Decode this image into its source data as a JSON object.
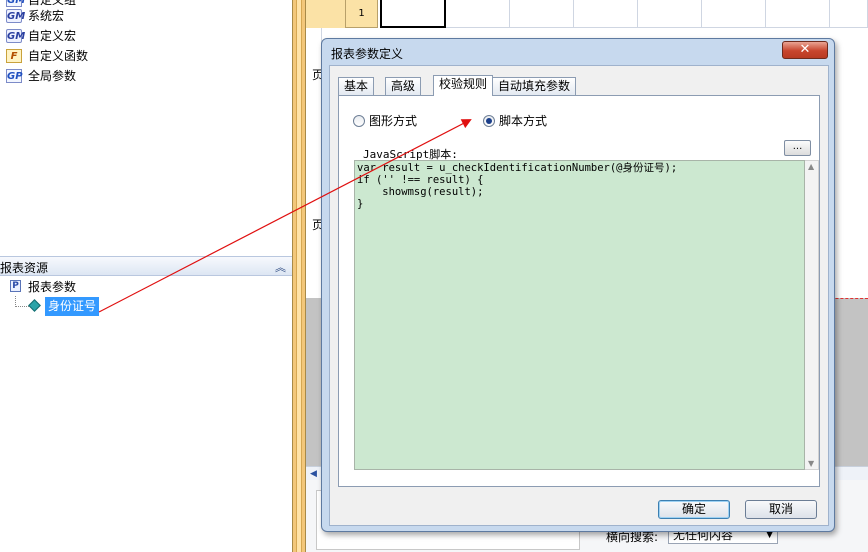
{
  "tree": {
    "items": [
      {
        "label": "自定义组",
        "icon": "group-icon"
      },
      {
        "label": "系统宏",
        "icon": "system-macro-icon"
      },
      {
        "label": "自定义宏",
        "icon": "custom-macro-icon"
      },
      {
        "label": "自定义函数",
        "icon": "custom-function-icon"
      },
      {
        "label": "全局参数",
        "icon": "global-param-icon"
      }
    ],
    "icon_text": {
      "macro": "GM",
      "func": "F",
      "global": "GP",
      "param": "P"
    }
  },
  "resources": {
    "header": "报表资源",
    "collapse_glyph": "︽",
    "params_label": "报表参数",
    "selected_param": "身份证号"
  },
  "designer": {
    "row_number": "1",
    "band_label_1": "页",
    "band_label_2": "页",
    "search_label": "横向搜索:",
    "search_value": "无任何内容"
  },
  "dialog": {
    "title": "报表参数定义",
    "close_glyph": "✕",
    "tabs": [
      {
        "label": "基本",
        "active": false
      },
      {
        "label": "高级",
        "active": false
      },
      {
        "label": "校验规则",
        "active": true
      },
      {
        "label": "自动填充参数",
        "active": false
      }
    ],
    "radio_graphic": "图形方式",
    "radio_script": "脚本方式",
    "selected_mode": "脚本方式",
    "script_label": "JavaScript脚本:",
    "more_button": "...",
    "script": "var result = u_checkIdentificationNumber(@身份证号);\nif ('' !== result) {\n    showmsg(result);\n}",
    "ok": "确定",
    "cancel": "取消"
  },
  "colors": {
    "editor_bg": "#cce8d0",
    "selection": "#3399ff",
    "arrow": "#e01010",
    "dialog_frame": "#c7d9ee"
  }
}
